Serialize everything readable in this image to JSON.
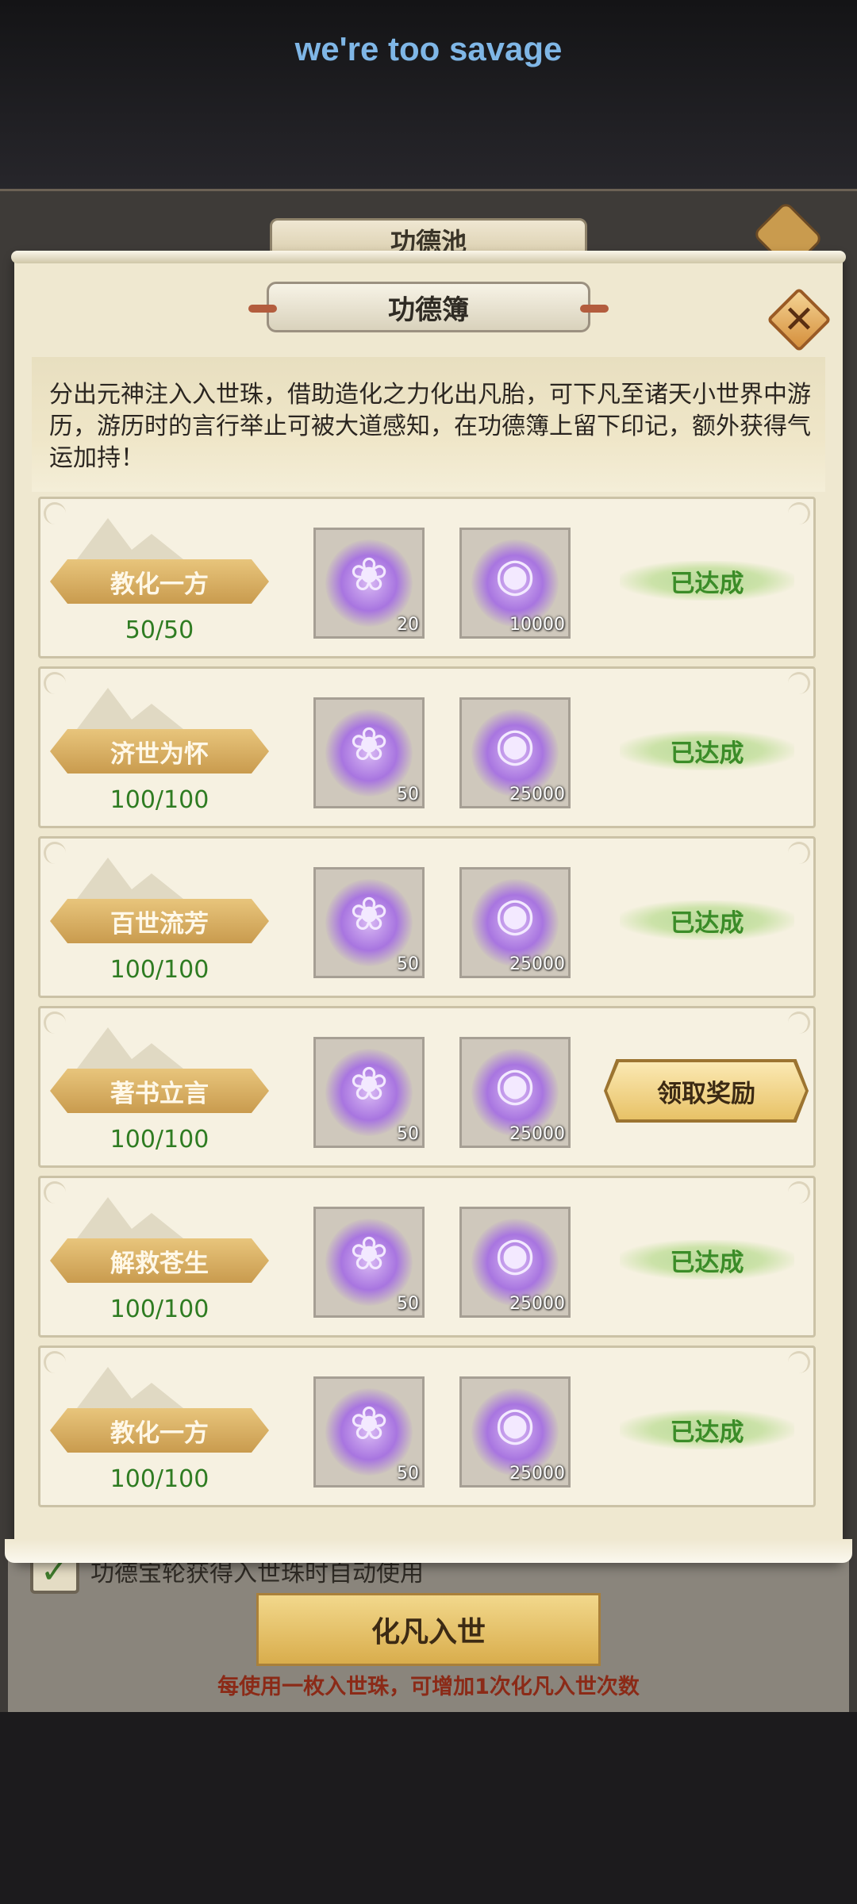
{
  "overlay": {
    "caption": "we're too savage"
  },
  "under": {
    "title": "功德池",
    "auto_use_label": "功德宝轮获得入世珠时自动使用",
    "auto_use_checked": "✓",
    "enter_button": "化凡入世",
    "hint": "每使用一枚入世珠，可增加1次化凡入世次数"
  },
  "dialog": {
    "title": "功德簿",
    "close_symbol": "✕",
    "description": "分出元神注入入世珠，借助造化之力化出凡胎，可下凡至诸天小世界中游历，游历时的言行举止可被大道感知，在功德簿上留下印记，额外获得气运加持！",
    "tasks": [
      {
        "name": "教化一方",
        "progress": "50/50",
        "reward1_icon": "lotus-icon",
        "reward1_qty": "20",
        "reward2_icon": "swirl-orb-icon",
        "reward2_qty": "10000",
        "status": "已达成"
      },
      {
        "name": "济世为怀",
        "progress": "100/100",
        "reward1_icon": "lotus-icon",
        "reward1_qty": "50",
        "reward2_icon": "swirl-orb-icon",
        "reward2_qty": "25000",
        "status": "已达成"
      },
      {
        "name": "百世流芳",
        "progress": "100/100",
        "reward1_icon": "lotus-icon",
        "reward1_qty": "50",
        "reward2_icon": "swirl-orb-icon",
        "reward2_qty": "25000",
        "status": "已达成"
      },
      {
        "name": "著书立言",
        "progress": "100/100",
        "reward1_icon": "lotus-icon",
        "reward1_qty": "50",
        "reward2_icon": "swirl-orb-icon",
        "reward2_qty": "25000",
        "status": "领取奖励"
      },
      {
        "name": "解救苍生",
        "progress": "100/100",
        "reward1_icon": "lotus-icon",
        "reward1_qty": "50",
        "reward2_icon": "swirl-orb-icon",
        "reward2_qty": "25000",
        "status": "已达成"
      },
      {
        "name": "教化一方",
        "progress": "100/100",
        "reward1_icon": "lotus-icon",
        "reward1_qty": "50",
        "reward2_icon": "swirl-orb-icon",
        "reward2_qty": "25000",
        "status": "已达成"
      }
    ]
  },
  "colors": {
    "progress_green": "#2f7c22",
    "done_green": "#3b8c28",
    "gold_plate": "#c99b4e",
    "hint_red": "#8b2a17",
    "caption_blue": "#7fb6e6"
  }
}
